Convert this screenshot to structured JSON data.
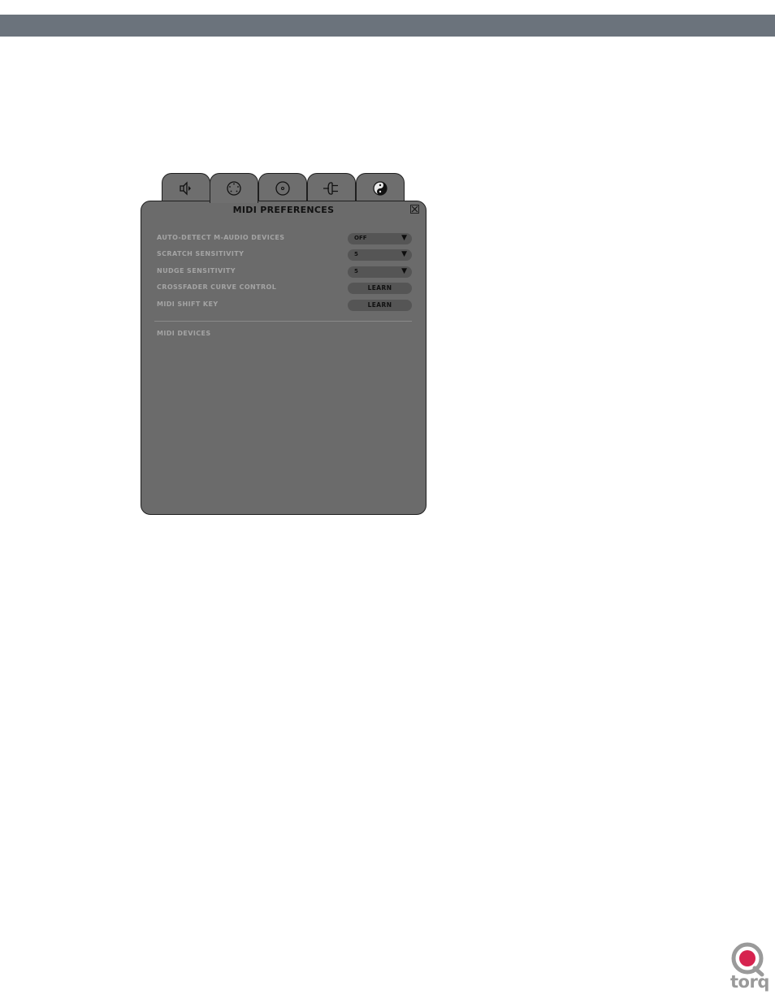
{
  "panel": {
    "title": "MIDI PREFERENCES"
  },
  "tabs": [
    {
      "icon": "speaker-icon",
      "active": false
    },
    {
      "icon": "midi-port-icon",
      "active": true
    },
    {
      "icon": "cd-icon",
      "active": false
    },
    {
      "icon": "plug-icon",
      "active": false
    },
    {
      "icon": "yin-yang-icon",
      "active": false
    }
  ],
  "settings": [
    {
      "label": "AUTO-DETECT M-AUDIO DEVICES",
      "type": "dropdown",
      "value": "OFF"
    },
    {
      "label": "SCRATCH SENSITIVITY",
      "type": "dropdown",
      "value": "5"
    },
    {
      "label": "NUDGE SENSITIVITY",
      "type": "dropdown",
      "value": "5"
    },
    {
      "label": "CROSSFADER CURVE CONTROL",
      "type": "button",
      "value": "LEARN"
    },
    {
      "label": "MIDI SHIFT KEY",
      "type": "button",
      "value": "LEARN"
    }
  ],
  "midi_devices": {
    "label": "MIDI DEVICES"
  },
  "logo": {
    "text": "torq"
  },
  "colors": {
    "band": "#6b737c",
    "panel": "#6b6b6b",
    "logo_accent": "#d6234f",
    "logo_gray": "#9a9a9a"
  }
}
